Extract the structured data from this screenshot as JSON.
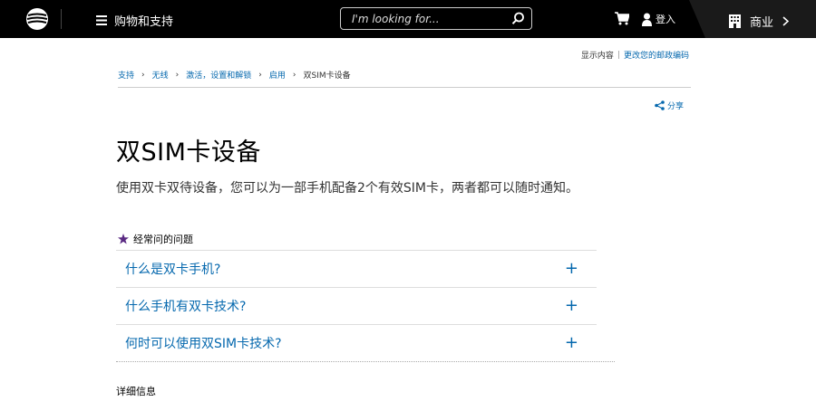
{
  "header": {
    "menu_label": "购物和支持",
    "search_placeholder": "I'm looking for...",
    "login_label": "登入",
    "business_label": "商业"
  },
  "utility": {
    "display_content": "显示内容",
    "separator": "|",
    "change_zip": "更改您的邮政编码"
  },
  "breadcrumb": {
    "items": [
      "支持",
      "无线",
      "激活，设置和解锁",
      "启用",
      "双SIM卡设备"
    ]
  },
  "share_label": "分享",
  "page": {
    "title": "双SIM卡设备",
    "intro": "使用双卡双待设备，您可以为一部手机配备2个有效SIM卡，两者都可以随时通知。"
  },
  "faq": {
    "heading": "经常问的问题",
    "items": [
      {
        "question": "什么是双卡手机?",
        "toggle": "+"
      },
      {
        "question": "什么手机有双卡技术?",
        "toggle": "+"
      },
      {
        "question": "何时可以使用双SIM卡技术?",
        "toggle": "+"
      }
    ]
  },
  "more_info": "详细信息",
  "colors": {
    "topbar": "#000000",
    "link": "#0568ae",
    "star": "#5a2a82"
  }
}
